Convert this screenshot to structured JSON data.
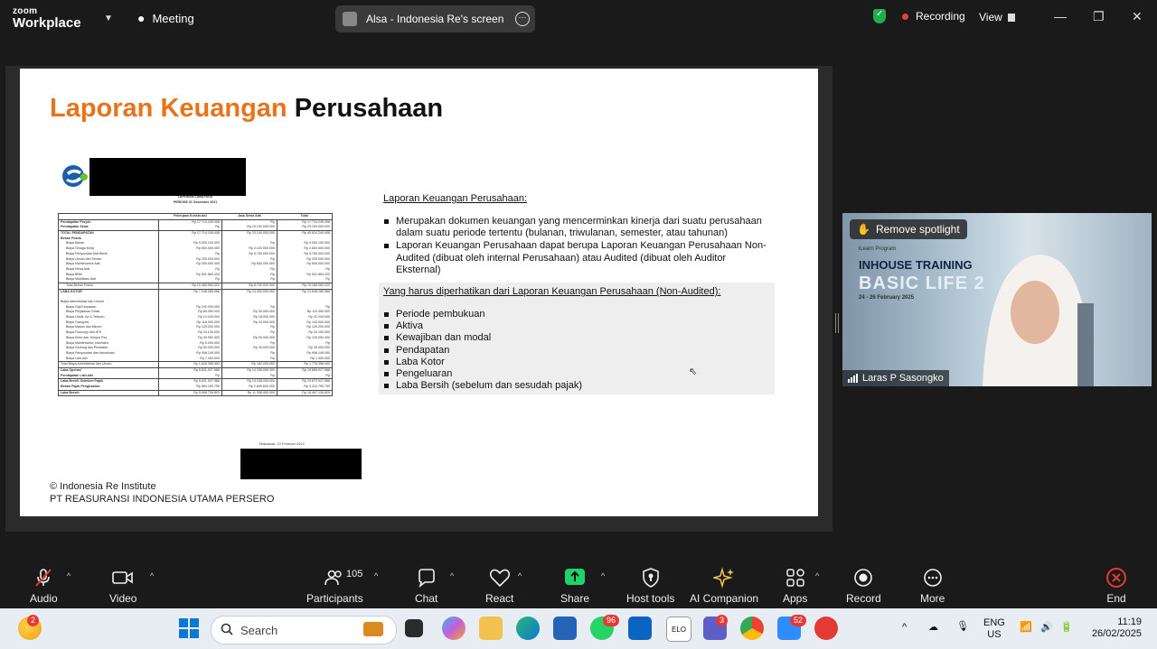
{
  "window": {
    "app_brand_line1": "zoom",
    "app_brand_line2": "Workplace",
    "meeting_label": "Meeting",
    "screen_share_title": "Alsa - Indonesia Re's screen",
    "recording_label": "Recording",
    "view_label": "View"
  },
  "slide": {
    "title_orange": "Laporan Keuangan",
    "title_black": "Perusahaan",
    "section1_heading": "Laporan Keuangan Perusahaan:",
    "section1_bullets": [
      "Merupakan dokumen keuangan yang mencerminkan kinerja dari suatu perusahaan dalam suatu periode tertentu (bulanan, triwulanan, semester, atau tahunan)",
      "Laporan Keuangan Perusahaan dapat berupa Laporan Keuangan Perusahaan Non-Audited (dibuat oleh internal Perusahaan) atau Audited (dibuat oleh Auditor Eksternal)"
    ],
    "section2_heading": "Yang harus diperhatikan dari Laporan Keuangan Perusahaan (Non-Audited):",
    "section2_bullets": [
      "Periode pembukuan",
      "Aktiva",
      "Kewajiban dan modal",
      "Pendapatan",
      "Laba Kotor",
      "Pengeluaran",
      "Laba Bersih (sebelum dan sesudah pajak)"
    ],
    "footer_line1": "© Indonesia Re Institute",
    "footer_line2": "PT REASURANSI INDONESIA UTAMA PERSERO",
    "doc_caption1": "LAPORAN LABA RUGI",
    "doc_caption2": "PERIODE 31 Desember 2021",
    "doc_headers": [
      "",
      "Pekerjaan Konstruksi",
      "Jasa Sewa Alat",
      "Total"
    ],
    "doc_rows": [
      [
        "Pendapatan Proyek",
        "Rp  17.714.249.408",
        "Rp",
        "Rp  17.714.249.408"
      ],
      [
        "Pendapatan Sewa",
        "Rp",
        "Rp  23.100.000.000",
        "Rp  23.100.000.000"
      ],
      [
        "TOTAL PENDAPATAN",
        "Rp  17.714.249.408",
        "Rp  23.100.000.000",
        "Rp  40.814.249.408"
      ],
      [
        "Beban Pokok",
        "",
        "",
        ""
      ],
      [
        "Biaya Bahan",
        "Rp  9.000.100.000",
        "Rp",
        "Rp  9.000.100.000"
      ],
      [
        "Biaya Tenaga Kerja",
        "Rp  500.000.000",
        "Rp  2.100.000.000",
        "Rp  2.600.000.000"
      ],
      [
        "Biaya Penyusutan Alat Berat",
        "Rp",
        "Rp  5.760.000.000",
        "Rp  5.760.000.000"
      ],
      [
        "Biaya Umum dan Tender",
        "Rp  200.000.000",
        "Rp",
        "Rp  200.000.000"
      ],
      [
        "Biaya Maintenance Alat",
        "Rp  300.000.000",
        "Rp  840.000.000",
        "Rp  840.000.000"
      ],
      [
        "Biaya Sewa Alat",
        "Rp",
        "Rp",
        "Rp"
      ],
      [
        "Biaya BBM",
        "Rp  531.863.420",
        "Rp",
        "Rp  531.863.420"
      ],
      [
        "Biaya Mobilisasi Alat",
        "Rp",
        "Rp",
        "Rp"
      ],
      [
        "Total Beban Pokok",
        "Rp  10.465.963.420",
        "Rp  8.700.000.000",
        "Rp  19.165.963.420"
      ],
      [
        "LABA KOTOR",
        "Rp  7.248.285.988",
        "Rp  14.400.000.000",
        "Rp  21.648.285.988"
      ],
      [
        "",
        "",
        "",
        ""
      ],
      [
        "Biaya Administrasi dan Umum",
        "",
        "",
        ""
      ],
      [
        "Biaya Gaji Karyawan",
        "Rp  192.000.000",
        "Rp",
        "Rp"
      ],
      [
        "Biaya Perjalanan Dinas",
        "Rp  80.350.000",
        "Rp  30.000.000",
        "Rp  110.350.000"
      ],
      [
        "Biaya Listrik, Air & Telepon",
        "Rp  14.240.000",
        "Rp  18.000.000",
        "Rp  32.240.000"
      ],
      [
        "Biaya Transport",
        "Rp  118.000.000",
        "Rp  24.000.000",
        "Rp  142.000.000"
      ],
      [
        "Biaya Makan dan Minum",
        "Rp  120.200.000",
        "Rp",
        "Rp  120.200.000"
      ],
      [
        "Biaya Fotocopy dan ATK",
        "Rp  20.100.000",
        "Rp",
        "Rp  20.100.000"
      ],
      [
        "Biaya Kirim dan Jemput Pos",
        "Rp  30.052.400",
        "Rp  90.000.000",
        "Rp  120.052.400"
      ],
      [
        "Biaya Maintenance Inventaris",
        "Rp  5.000.000",
        "Rp",
        "Rp"
      ],
      [
        "Biaya Gedung dan Peralatan",
        "Rp  50.000.000",
        "Rp  30.000.000",
        "Rp  30.000.000"
      ],
      [
        "Biaya Penyusutan dan Amortisasi",
        "Rp  908.149.000",
        "Rp",
        "Rp  908.149.000"
      ],
      [
        "Biaya Lain-lain",
        "Rp  7.400.000",
        "Rp",
        "Rp  1.400.000"
      ],
      [
        "Total Biaya Administrasi dan Umum",
        "Rp  1.616.358.400",
        "Rp  162.000.000",
        "Rp  1.778.358.400"
      ],
      [
        "Laba Operasi",
        "Rp  5.631.927.588",
        "Rp  14.238.000.000",
        "Rp  19.869.927.588"
      ],
      [
        "Pendapatan Lain-lain",
        "Rp",
        "Rp",
        "Rp"
      ],
      [
        "Laba Bersih Sebelum Pajak",
        "Rp  5.631.927.588",
        "Rp  14.238.000.000",
        "Rp  19.873.927.588"
      ],
      [
        "Beban Pajak Penghasilan",
        "Rp  563.190.759",
        "Rp  2.849.600.000",
        "Rp  3.412.790.759"
      ],
      [
        "Laba Bersih",
        "Rp  5.068.736.829",
        "Rp  11.398.400.000",
        "Rp  16.467.136.829"
      ]
    ],
    "doc_sign_place": "Makassar, 10 Februari 2022"
  },
  "video": {
    "spotlight_label": "Remove spotlight",
    "participant_name": "Laras P Sasongko",
    "bg_small_label": "iLearn Program",
    "bg_line1": "INHOUSE TRAINING",
    "bg_line2": "BASIC LIFE 2",
    "bg_dates": "24 - 26 February 2025"
  },
  "toolbar": {
    "audio": "Audio",
    "video": "Video",
    "participants": "Participants",
    "participants_count": "105",
    "chat": "Chat",
    "react": "React",
    "share": "Share",
    "host_tools": "Host tools",
    "ai_companion": "AI Companion",
    "apps": "Apps",
    "record": "Record",
    "more": "More",
    "end": "End"
  },
  "taskbar": {
    "search_placeholder": "Search",
    "weather_badge": "2",
    "whatsapp_badge": "96",
    "teams_badge": "3",
    "zoom_badge": "52",
    "language_line1": "ENG",
    "language_line2": "US",
    "time": "11:19",
    "date": "26/02/2025"
  },
  "colors": {
    "accent_orange": "#e8731a",
    "share_green": "#1fd26b",
    "end_red": "#e53935"
  }
}
